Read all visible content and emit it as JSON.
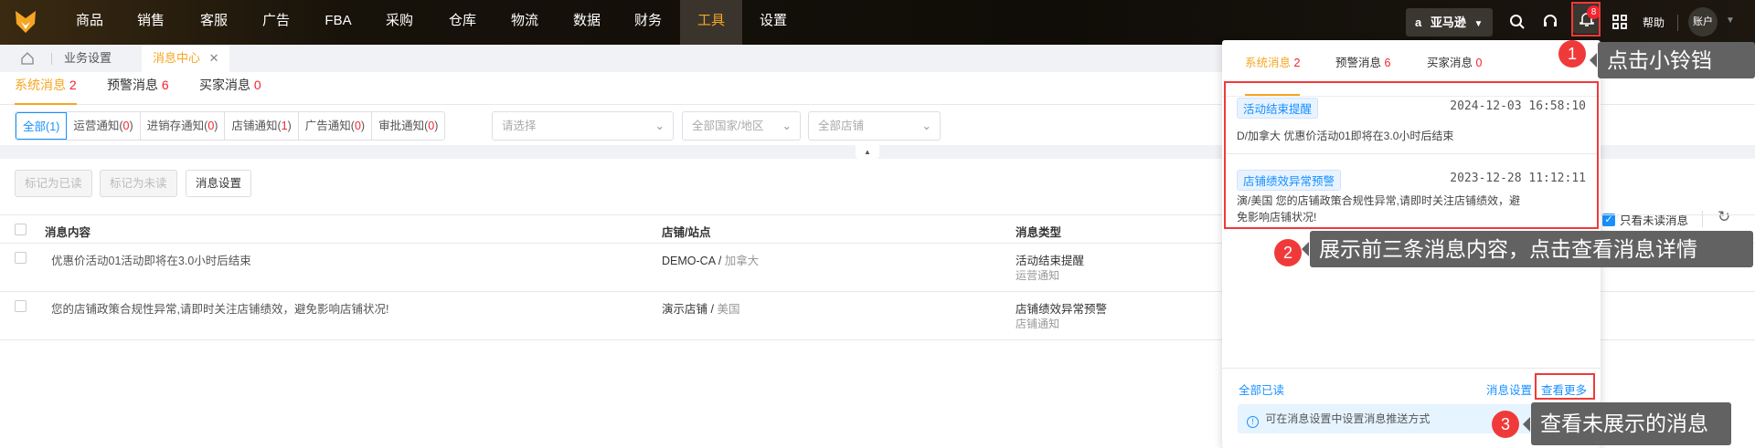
{
  "nav": {
    "items": [
      "商品",
      "销售",
      "客服",
      "广告",
      "FBA",
      "采购",
      "仓库",
      "物流",
      "数据",
      "财务",
      "工具",
      "设置"
    ],
    "active": "工具",
    "platform": "亚马逊",
    "help": "帮助",
    "account": "账户",
    "bell_badge": "8"
  },
  "page_tabs": {
    "items": [
      "业务设置",
      "消息中心"
    ],
    "active": "消息中心"
  },
  "subtabs": [
    {
      "label": "系统消息",
      "count": "2"
    },
    {
      "label": "预警消息",
      "count": "6"
    },
    {
      "label": "买家消息",
      "count": "0"
    }
  ],
  "filters": {
    "segments": [
      {
        "label": "全部",
        "count": "1"
      },
      {
        "label": "运营通知",
        "count": "0"
      },
      {
        "label": "进销存通知",
        "count": "0"
      },
      {
        "label": "店铺通知",
        "count": "1"
      },
      {
        "label": "广告通知",
        "count": "0"
      },
      {
        "label": "审批通知",
        "count": "0"
      }
    ],
    "select_placeholder": "请选择",
    "country_placeholder": "全部国家/地区",
    "store_placeholder": "全部店铺"
  },
  "toolbar": {
    "mark_read": "标记为已读",
    "mark_unread": "标记为未读",
    "settings": "消息设置",
    "only_unread": "只看未读消息"
  },
  "table": {
    "headers": [
      "消息内容",
      "店铺/站点",
      "消息类型"
    ],
    "rows": [
      {
        "content": "优惠价活动01活动即将在3.0小时后结束",
        "store": "DEMO-CA",
        "site": "加拿大",
        "type": "活动结束提醒",
        "category": "运营通知"
      },
      {
        "content": "您的店铺政策合规性异常,请即时关注店铺绩效，避免影响店铺状况!",
        "store": "演示店铺",
        "site": "美国",
        "type": "店铺绩效异常预警",
        "category": "店铺通知"
      }
    ]
  },
  "popup": {
    "tabs": [
      {
        "label": "系统消息",
        "count": "2"
      },
      {
        "label": "预警消息",
        "count": "6"
      },
      {
        "label": "买家消息",
        "count": "0"
      }
    ],
    "messages": [
      {
        "tag": "活动结束提醒",
        "date": "2024-12-03 16:58:10",
        "text": "D/加拿大 优惠价活动01即将在3.0小时后结束"
      },
      {
        "tag": "店铺绩效异常预警",
        "date": "2023-12-28 11:12:11",
        "text": "演/美国 您的店铺政策合规性异常,请即时关注店铺绩效，避免影响店铺状况!"
      }
    ],
    "mark_all_read": "全部已读",
    "settings": "消息设置",
    "view_more": "查看更多",
    "info": "可在消息设置中设置消息推送方式"
  },
  "annotations": [
    {
      "num": "1",
      "text": "点击小铃铛"
    },
    {
      "num": "2",
      "text": "展示前三条消息内容，点击查看消息详情"
    },
    {
      "num": "3",
      "text": "查看未展示的消息"
    }
  ],
  "colors": {
    "accent": "#f5a623",
    "link": "#1890ff",
    "badge": "#f5222d",
    "annotation_red": "#f03a3a"
  }
}
